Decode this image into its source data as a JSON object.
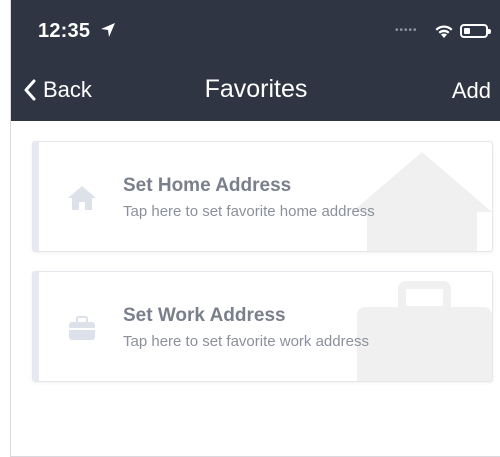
{
  "status_bar": {
    "time": "12:35",
    "signal_dots": "•••••"
  },
  "nav": {
    "back_label": "Back",
    "title": "Favorites",
    "add_label": "Add"
  },
  "favorites": [
    {
      "title": "Set Home Address",
      "subtitle": "Tap here to set favorite home address",
      "icon": "home-icon"
    },
    {
      "title": "Set Work Address",
      "subtitle": "Tap here to set favorite work address",
      "icon": "briefcase-icon"
    }
  ],
  "colors": {
    "nav_background": "#2f3542",
    "card_accent": "#e6e9f3",
    "text_primary": "#7a7f8b",
    "text_secondary": "#8b909b"
  }
}
